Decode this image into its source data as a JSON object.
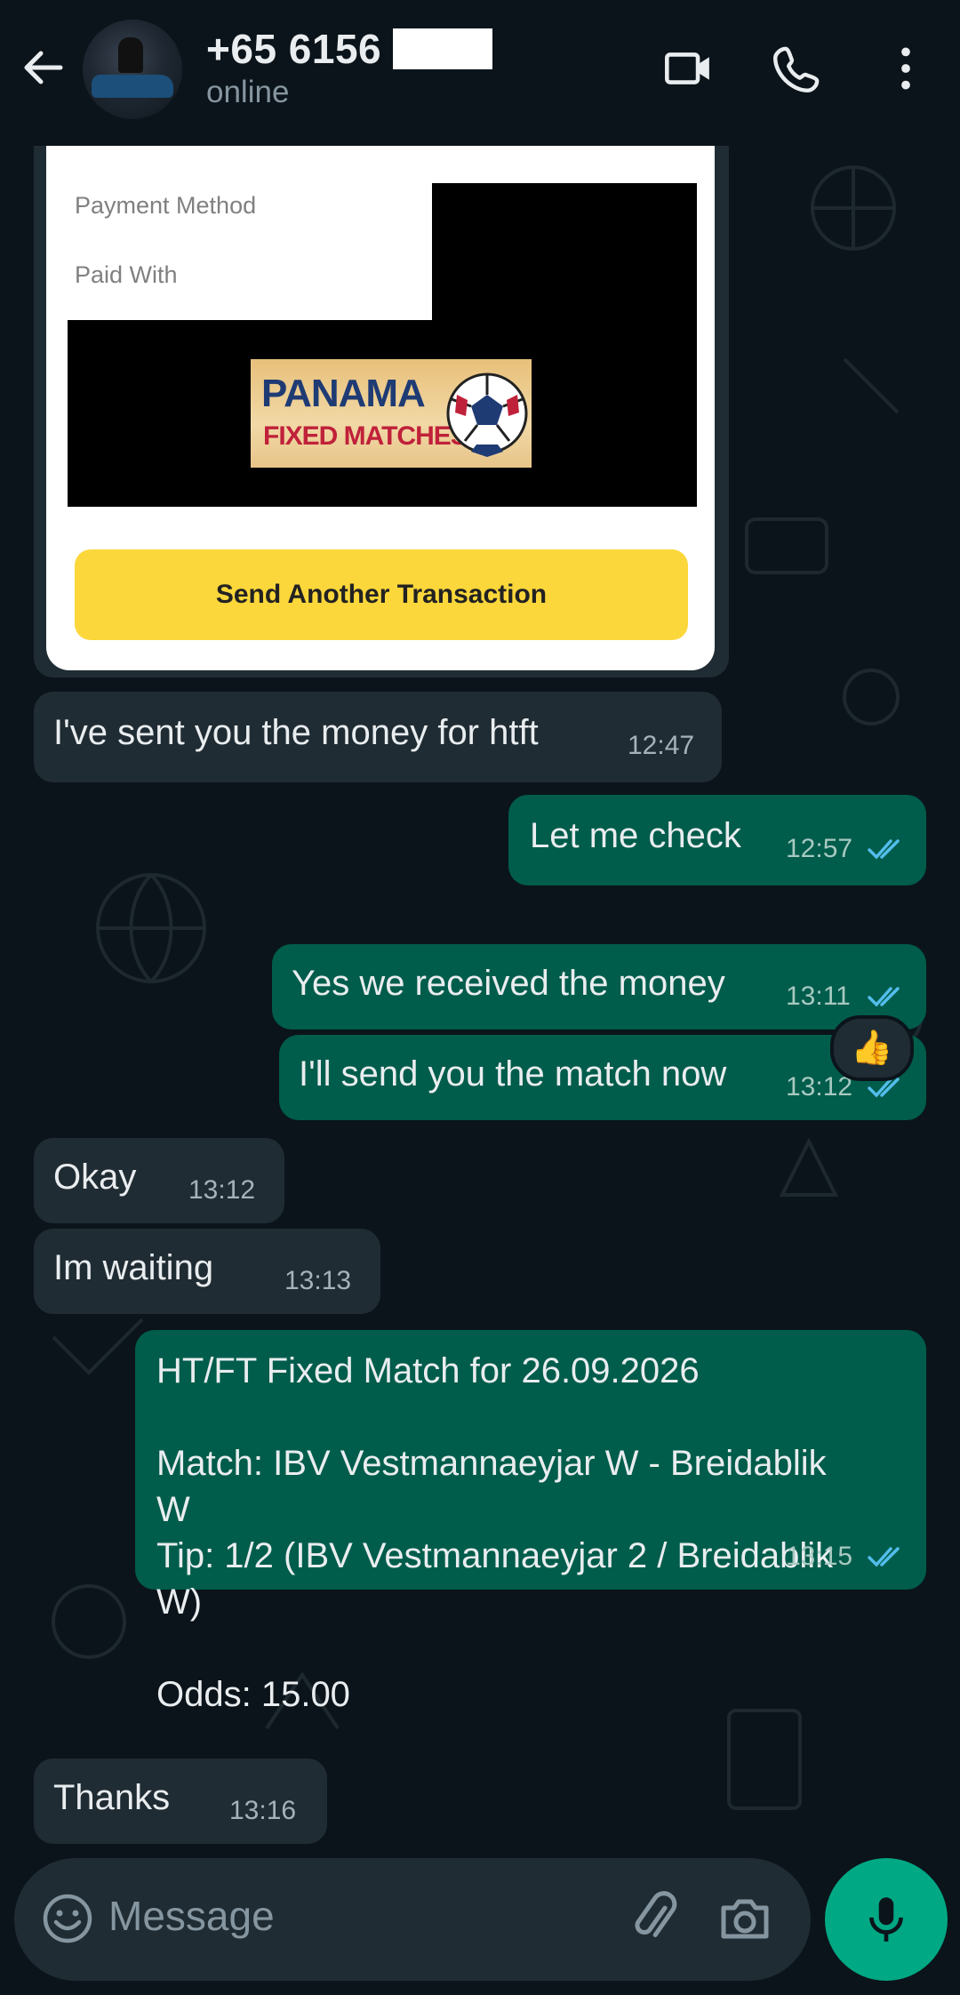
{
  "header": {
    "contact_name": "+65 6156",
    "status": "online"
  },
  "card": {
    "payment_method_label": "Payment Method",
    "paid_with_label": "Paid With",
    "logo_line1": "PANAMA",
    "logo_line2": "FIXED MATCHES",
    "button_label": "Send Another Transaction"
  },
  "messages": [
    {
      "dir": "in",
      "text": "I've sent you the money for htft",
      "time": "12:47"
    },
    {
      "dir": "out",
      "text": "Let me check",
      "time": "12:57",
      "read": true,
      "reaction": "👍"
    },
    {
      "dir": "out",
      "text": "Yes we received the money",
      "time": "13:11",
      "read": true
    },
    {
      "dir": "out",
      "text": "I'll send you the match now",
      "time": "13:12",
      "read": true
    },
    {
      "dir": "in",
      "text": "Okay",
      "time": "13:12"
    },
    {
      "dir": "in",
      "text": "Im waiting",
      "time": "13:13"
    },
    {
      "dir": "out",
      "text": "HT/FT Fixed Match for 26.09.2026\n\nMatch: IBV Vestmannaeyjar W - Breidablik\nW\nTip: 1/2 (IBV Vestmannaeyjar 2 / Breidablik\nW)\n\nOdds: 15.00",
      "time": "13:15",
      "read": true
    },
    {
      "dir": "in",
      "text": "Thanks",
      "time": "13:16"
    }
  ],
  "composer": {
    "placeholder": "Message"
  },
  "colors": {
    "background": "#0b141a",
    "incoming_bubble": "#202c33",
    "outgoing_bubble": "#005c4b",
    "read_ticks": "#53bdeb",
    "mic_button": "#00a884",
    "send_button": "#fcd73b"
  },
  "icons": [
    "back-arrow-icon",
    "video-call-icon",
    "phone-icon",
    "more-options-icon",
    "emoji-icon",
    "attach-icon",
    "camera-icon",
    "mic-icon",
    "read-ticks-icon"
  ]
}
